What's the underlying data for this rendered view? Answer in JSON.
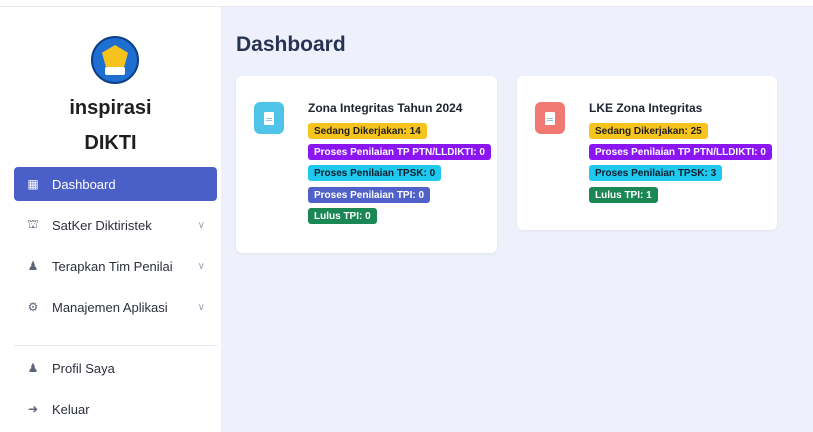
{
  "brand": {
    "line1": "inspirasi",
    "line2": "DIKTI"
  },
  "sidebar": {
    "items": [
      {
        "label": "Dashboard",
        "icon": "grid-icon"
      },
      {
        "label": "SatKer Diktiristek",
        "icon": "institution-icon"
      },
      {
        "label": "Terapkan Tim Penilai",
        "icon": "user-edit-icon"
      },
      {
        "label": "Manajemen Aplikasi",
        "icon": "gears-icon"
      }
    ],
    "bottom": [
      {
        "label": "Profil Saya",
        "icon": "user-icon"
      },
      {
        "label": "Keluar",
        "icon": "logout-icon"
      }
    ]
  },
  "main": {
    "title": "Dashboard",
    "cards": [
      {
        "title": "Zona Integritas Tahun 2024",
        "icon_color": "#4fc3e8",
        "badges": [
          "Sedang Dikerjakan: 14",
          "Proses Penilaian TP PTN/LLDIKTI: 0",
          "Proses Penilaian TPSK: 0",
          "Proses Penilaian TPI: 0",
          "Lulus TPI: 0"
        ]
      },
      {
        "title": "LKE Zona Integritas",
        "icon_color": "#f07a73",
        "badges": [
          "Sedang Dikerjakan: 25",
          "Proses Penilaian TP PTN/LLDIKTI: 0",
          "Proses Penilaian TPSK: 3",
          "Lulus TPI: 1"
        ]
      }
    ]
  },
  "colors": {
    "accent": "#4b5fc8",
    "background": "#eef1fb"
  }
}
